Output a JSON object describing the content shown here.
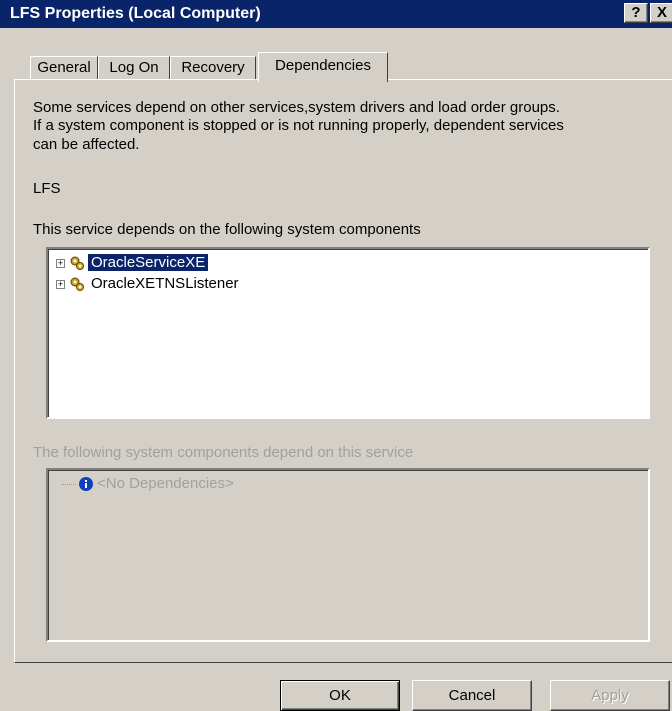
{
  "window": {
    "title": "LFS Properties (Local Computer)",
    "help_label": "?",
    "close_label": "X"
  },
  "tabs": [
    {
      "label": "General",
      "active": false
    },
    {
      "label": "Log On",
      "active": false
    },
    {
      "label": "Recovery",
      "active": false
    },
    {
      "label": "Dependencies",
      "active": true
    }
  ],
  "dependencies": {
    "description_line1": "Some services depend on other services,system drivers and load order groups.",
    "description_line2": "If a system component is stopped or is not running properly, dependent services",
    "description_line3": "can be affected.",
    "service_name": "LFS",
    "depends_on_label": "This service depends on the following system components",
    "depends_on_items": [
      {
        "label": "OracleServiceXE",
        "selected": true,
        "icon": "gear-icon"
      },
      {
        "label": "OracleXETNSListener",
        "selected": false,
        "icon": "gear-icon"
      }
    ],
    "dependents_label": "The following system components depend on this service",
    "dependents_items": [
      {
        "label": "<No Dependencies>",
        "icon": "info-icon"
      }
    ]
  },
  "buttons": {
    "ok": "OK",
    "cancel": "Cancel",
    "apply": "Apply"
  },
  "colors": {
    "titlebar": "#0a246a",
    "face": "#d4d0c8",
    "selection": "#0a246a"
  }
}
